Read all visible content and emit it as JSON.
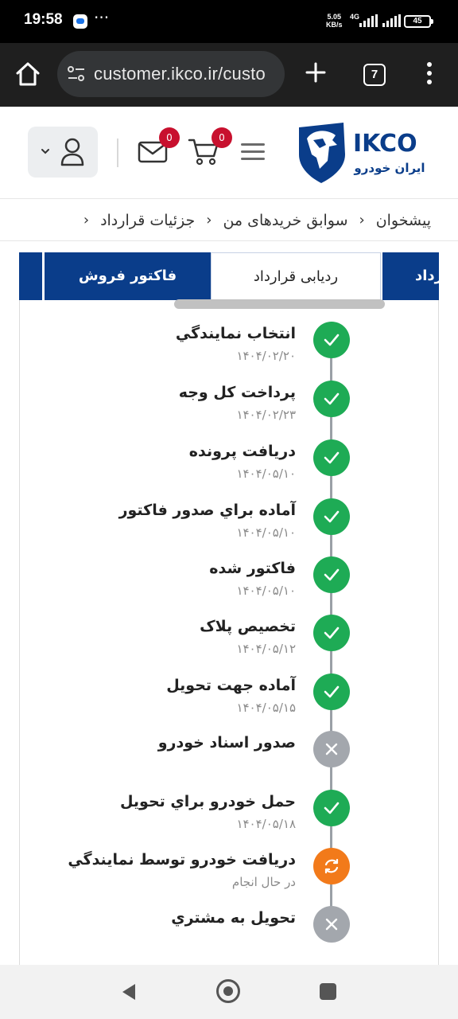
{
  "status_bar": {
    "time": "19:58",
    "speed_value": "5.05",
    "speed_unit": "KB/s",
    "network": "4G",
    "battery": "45"
  },
  "browser": {
    "url": "customer.ikco.ir/custo",
    "tab_count": "7"
  },
  "header": {
    "mail_badge": "0",
    "cart_badge": "0",
    "logo_text": "IKCO",
    "logo_subtext": "ایران خودرو",
    "brand_color": "#0a3d8a"
  },
  "breadcrumb": {
    "items": [
      "پیشخوان",
      "سوابق خریدهای من",
      "جزئیات قرارداد"
    ]
  },
  "tabs": {
    "items": [
      "رداد",
      "ردیابی قرارداد",
      "فاکتور فروش"
    ],
    "active_index": 1
  },
  "timeline": {
    "steps": [
      {
        "title": "انتخاب نمايندگي",
        "date": "۱۴۰۴/۰۲/۲۰",
        "status": "done"
      },
      {
        "title": "پرداخت کل وجه",
        "date": "۱۴۰۴/۰۲/۲۳",
        "status": "done"
      },
      {
        "title": "دريافت پرونده",
        "date": "۱۴۰۴/۰۵/۱۰",
        "status": "done"
      },
      {
        "title": "آماده براي صدور فاکتور",
        "date": "۱۴۰۴/۰۵/۱۰",
        "status": "done"
      },
      {
        "title": "فاکتور شده",
        "date": "۱۴۰۴/۰۵/۱۰",
        "status": "done"
      },
      {
        "title": "تخصيص پلاک",
        "date": "۱۴۰۴/۰۵/۱۲",
        "status": "done"
      },
      {
        "title": "آماده جهت تحويل",
        "date": "۱۴۰۴/۰۵/۱۵",
        "status": "done"
      },
      {
        "title": "صدور اسناد خودرو",
        "date": "",
        "status": "skipped"
      },
      {
        "title": "حمل خودرو براي تحويل",
        "date": "۱۴۰۴/۰۵/۱۸",
        "status": "done"
      },
      {
        "title": "دريافت خودرو توسط نمايندگي",
        "date": "در حال انجام",
        "status": "in-progress"
      },
      {
        "title": "تحويل به مشتري",
        "date": "",
        "status": "skipped"
      }
    ]
  }
}
